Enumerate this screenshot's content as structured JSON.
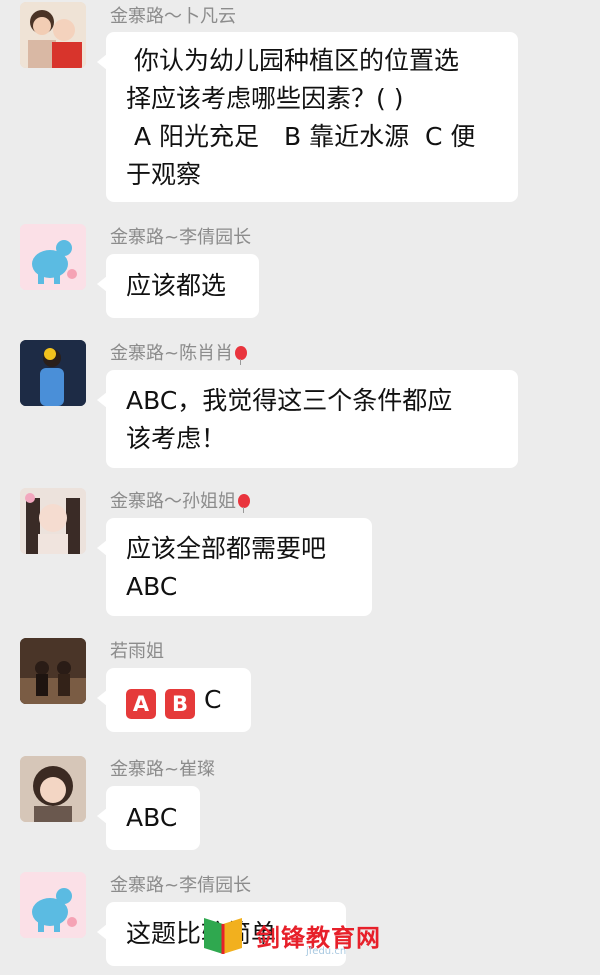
{
  "messages": [
    {
      "sender": "金寨路～卜凡云",
      "text": " 你认为幼儿园种植区的位置选\n择应该考虑哪些因素？( )\n A 阳光充足　B 靠近水源  C 便\n于观察"
    },
    {
      "sender": "金寨路~李倩园长",
      "text": "应该都选"
    },
    {
      "sender": "金寨路~陈肖肖",
      "text": "ABC，我觉得这三个条件都应\n该考虑！"
    },
    {
      "sender": "金寨路～孙姐姐",
      "text": "应该全部都需要吧\nABC"
    },
    {
      "sender": "若雨姐",
      "emoji_a": "A",
      "emoji_b": "B",
      "text": "C"
    },
    {
      "sender": "金寨路~崔璨",
      "text": "ABC"
    },
    {
      "sender": "金寨路~李倩园长",
      "text": "这题比较简单"
    }
  ],
  "watermark": {
    "text": "剑锋教育网",
    "url": "jfedu.cn"
  },
  "colors": {
    "background": "#ececec",
    "bubble": "#ffffff",
    "sender": "#8c8c8c",
    "emoji_red": "#e53a3a",
    "watermark_red": "#e7202a"
  }
}
